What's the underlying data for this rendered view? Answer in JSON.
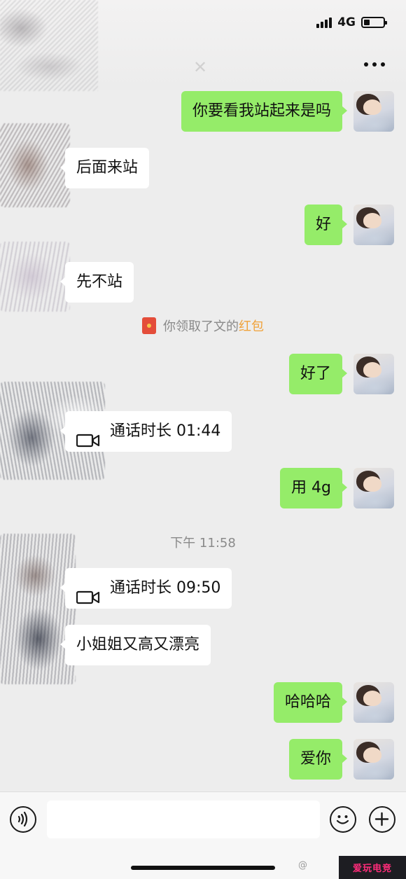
{
  "status_bar": {
    "network": "4G",
    "battery_level": 0.3,
    "signal_bars": 4
  },
  "header": {
    "more_icon": "more-dots-icon"
  },
  "messages": [
    {
      "side": "out",
      "text": "你要看我站起来是吗"
    },
    {
      "side": "in",
      "text": "后面来站"
    },
    {
      "side": "out",
      "text": "好"
    },
    {
      "side": "in",
      "text": "先不站"
    },
    {
      "side": "out",
      "text": "好了"
    },
    {
      "side": "in",
      "type": "video_call",
      "text": "通话时长 01:44"
    },
    {
      "side": "out",
      "text": "用 4g"
    },
    {
      "side": "in",
      "type": "video_call",
      "text": "通话时长 09:50"
    },
    {
      "side": "in",
      "text": "小姐姐又高又漂亮"
    },
    {
      "side": "out",
      "text": "哈哈哈"
    },
    {
      "side": "out",
      "text": "爱你"
    }
  ],
  "system": {
    "red_packet_text": "你领取了文的",
    "red_packet_link": "红包",
    "timestamp": "下午 11:58"
  },
  "input_bar": {
    "value": "",
    "placeholder": ""
  },
  "watermark": {
    "text": "爱玩电竞",
    "prefix": "@"
  },
  "colors": {
    "outgoing_bubble": "#95ec69",
    "incoming_bubble": "#ffffff",
    "red_packet_link": "#f0a23a",
    "background": "#ededed"
  }
}
